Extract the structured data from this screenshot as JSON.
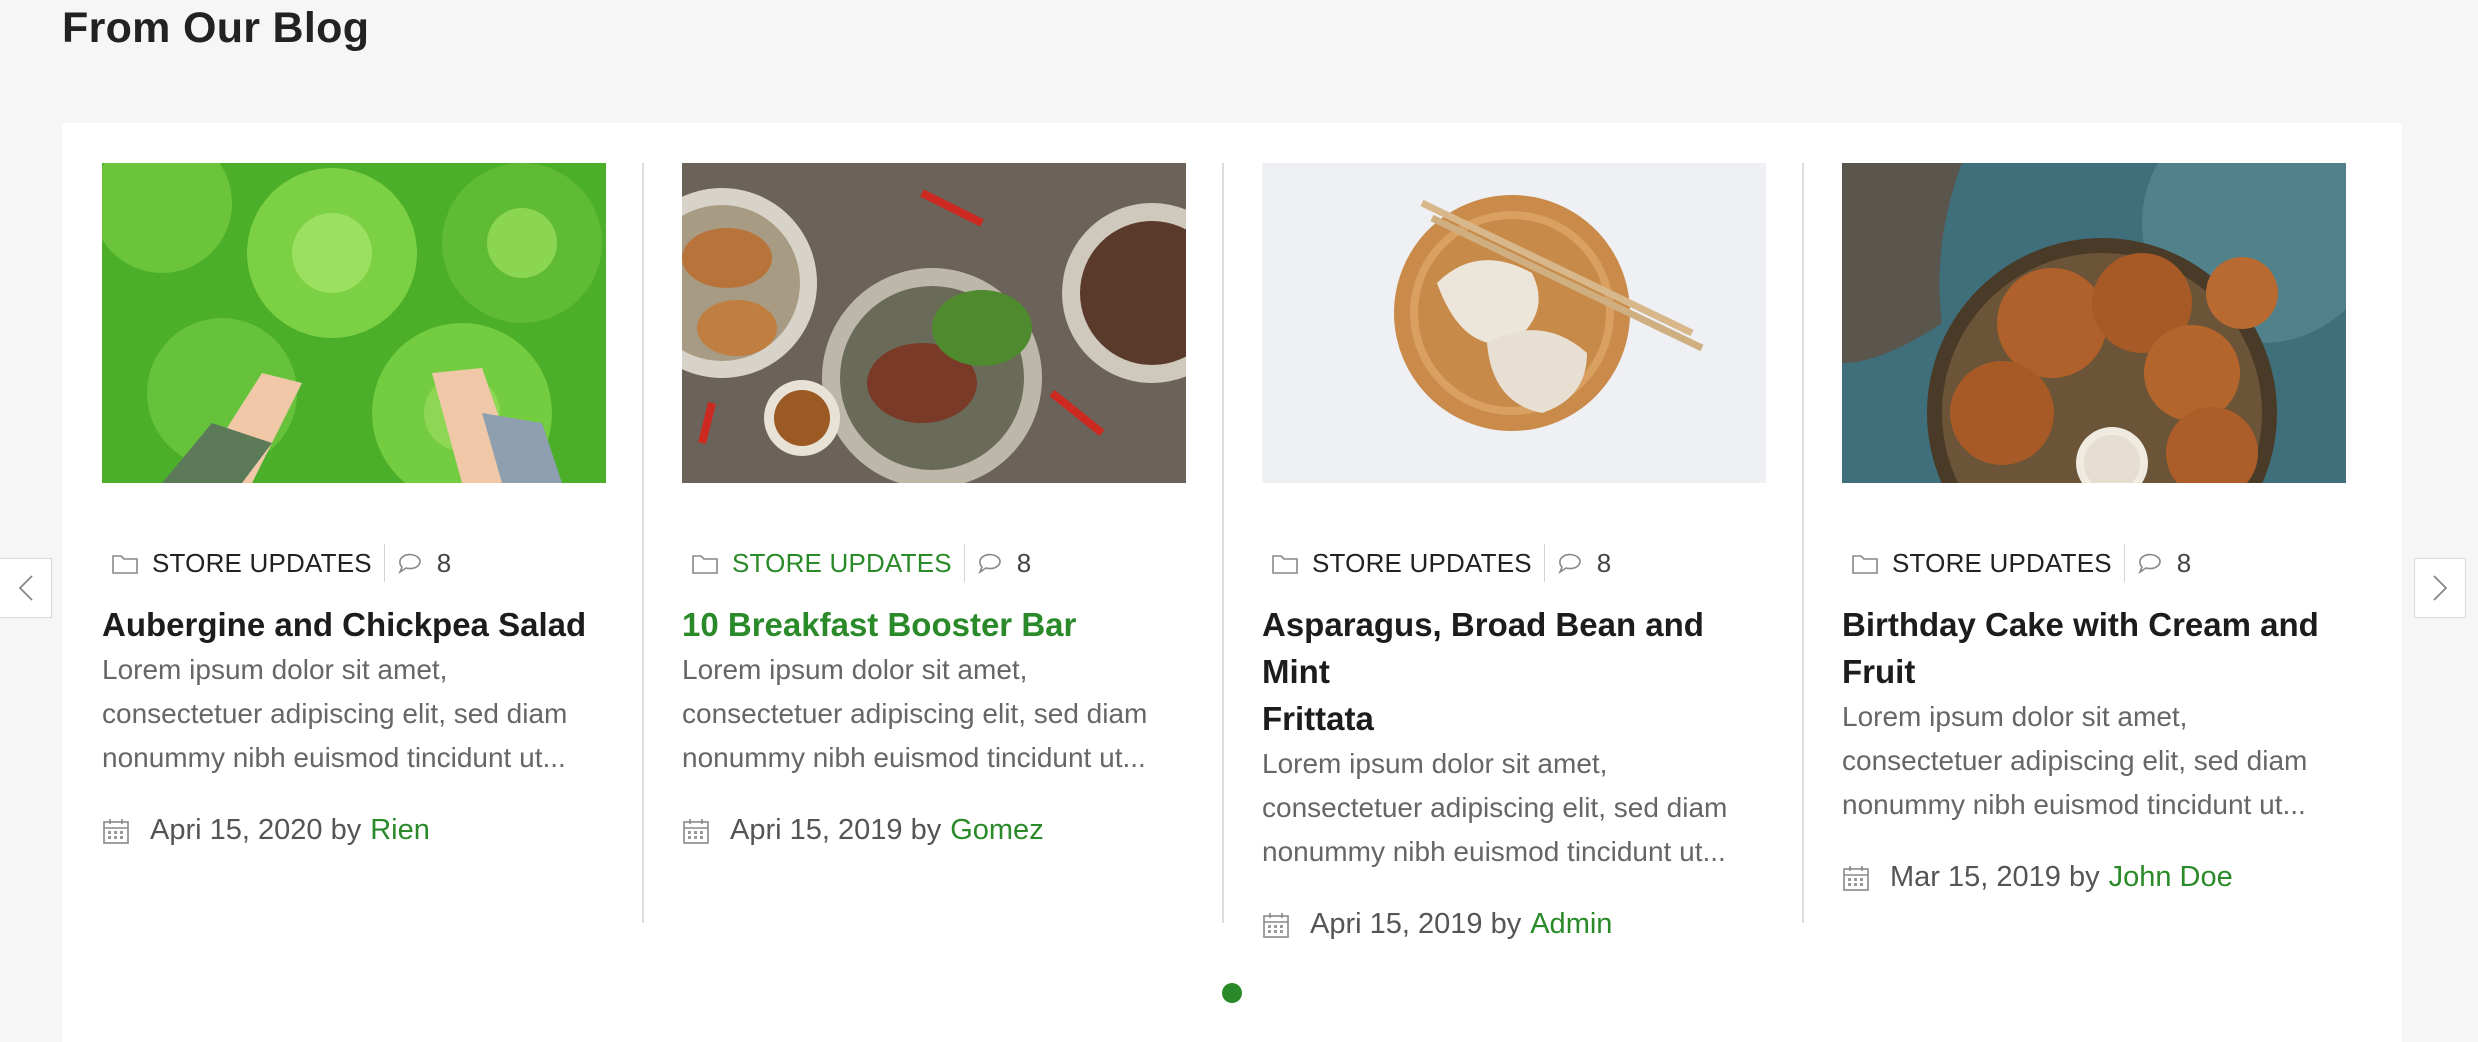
{
  "section": {
    "title": "From Our Blog"
  },
  "posts": [
    {
      "category": "STORE UPDATES",
      "comments": "8",
      "title": "Aubergine and Chickpea Salad",
      "excerpt": [
        "Lorem ipsum dolor sit amet,",
        "consectetuer adipiscing elit, sed diam",
        "nonummy nibh euismod tincidunt ut..."
      ],
      "date": "Apri 15, 2020",
      "by": "by",
      "author": "Rien"
    },
    {
      "category": "STORE UPDATES",
      "comments": "8",
      "title": "10 Breakfast Booster Bar",
      "excerpt": [
        "Lorem ipsum dolor sit amet,",
        "consectetuer adipiscing elit, sed diam",
        "nonummy nibh euismod tincidunt ut..."
      ],
      "date": "Apri 15, 2019",
      "by": "by",
      "author": "Gomez"
    },
    {
      "category": "STORE UPDATES",
      "comments": "8",
      "title_lines": [
        "Asparagus, Broad Bean and Mint",
        "Frittata"
      ],
      "excerpt": [
        "Lorem ipsum dolor sit amet,",
        "consectetuer adipiscing elit, sed diam",
        "nonummy nibh euismod tincidunt ut..."
      ],
      "date": "Apri 15, 2019",
      "by": "by",
      "author": "Admin"
    },
    {
      "category": "STORE UPDATES",
      "comments": "8",
      "title_lines": [
        "Birthday Cake with Cream and",
        "Fruit"
      ],
      "excerpt": [
        "Lorem ipsum dolor sit amet,",
        "consectetuer adipiscing elit, sed diam",
        "nonummy nibh euismod tincidunt ut..."
      ],
      "date": "Mar 15, 2019",
      "by": "by",
      "author": "John Doe"
    }
  ],
  "colors": {
    "accent": "#2a8a2a",
    "text": "#222222",
    "muted": "#666666",
    "background": "#f6f6f6"
  },
  "carousel": {
    "active_page": 1,
    "pages": 1,
    "prev_icon": "chevron-left-icon",
    "next_icon": "chevron-right-icon"
  }
}
